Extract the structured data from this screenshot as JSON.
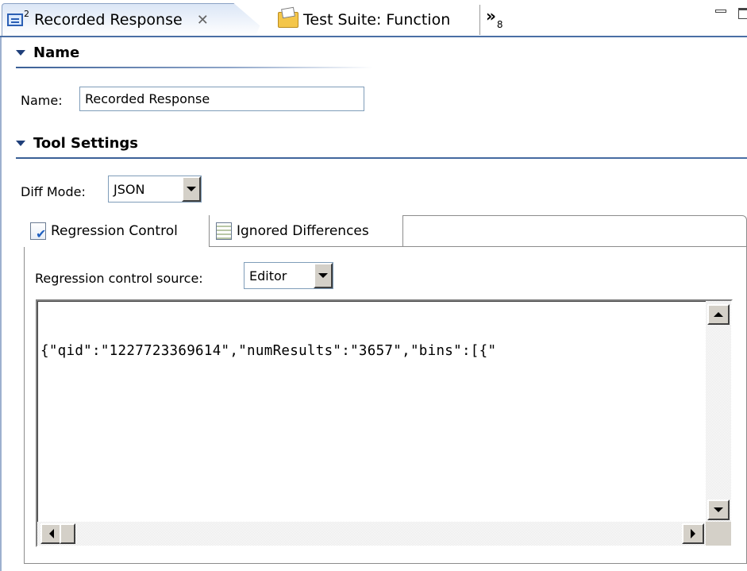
{
  "editor_tabs": {
    "active": {
      "label": "Recorded Response",
      "icon": "editor-icon",
      "superscript": "2"
    },
    "inactive": {
      "label": "Test Suite: Function",
      "icon": "folder-test-icon"
    },
    "overflow": {
      "symbol": "»",
      "count": "8"
    }
  },
  "name_section": {
    "title": "Name",
    "name_label": "Name:",
    "name_value": "Recorded Response"
  },
  "tool_settings": {
    "title": "Tool Settings",
    "diff_mode_label": "Diff Mode:",
    "diff_mode_value": "JSON",
    "tabs": [
      {
        "label": "Regression Control",
        "icon": "regression-control-icon"
      },
      {
        "label": "Ignored Differences",
        "icon": "ignored-differences-icon"
      }
    ],
    "regression_source_label": "Regression control source:",
    "regression_source_value": "Editor",
    "editor_text": "{\"qid\":\"1227723369614\",\"numResults\":\"3657\",\"bins\":[{\""
  },
  "colors": {
    "accent": "#4a6fa5",
    "section_line": "#3a5f96",
    "widget_face": "#d4d0c8"
  }
}
